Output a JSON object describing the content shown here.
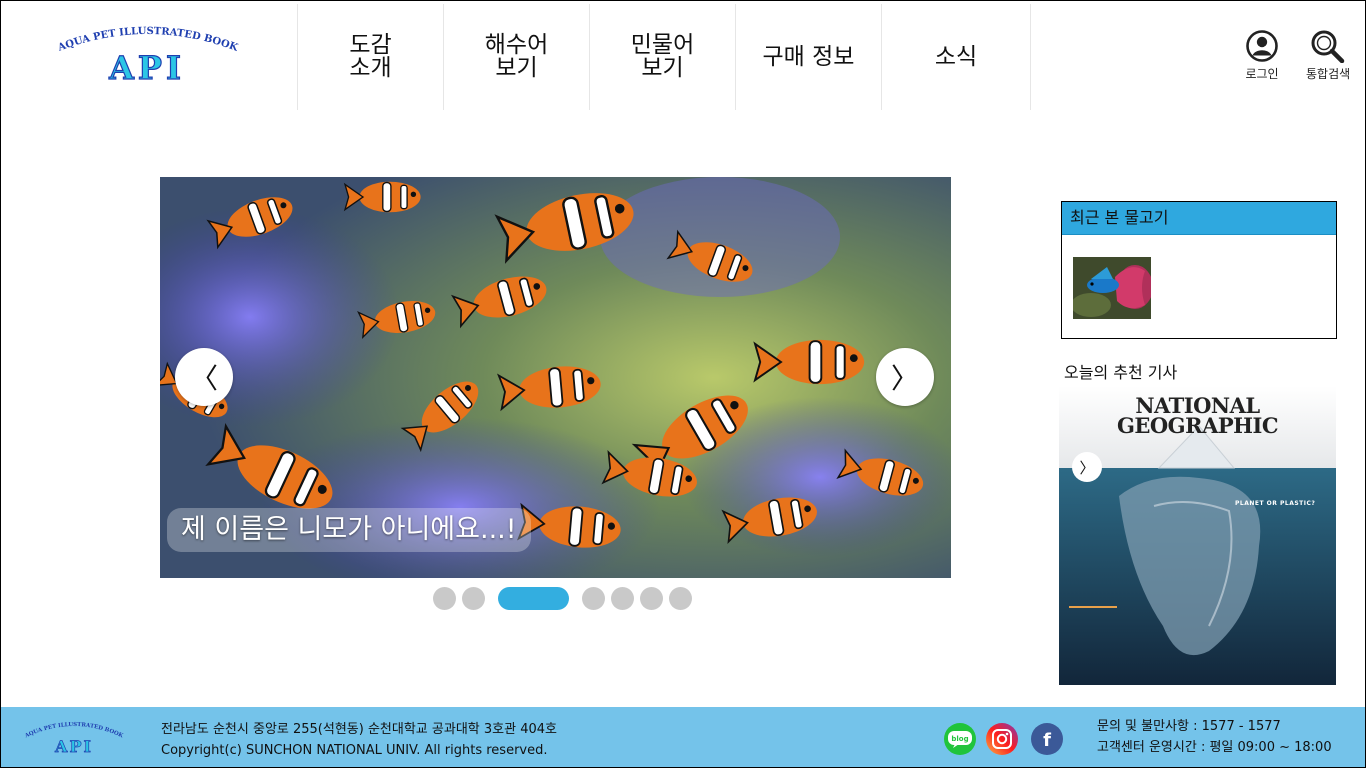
{
  "brand": {
    "logo_text": "API",
    "logo_arc_text": "AQUA PET ILLUSTRATED BOOK"
  },
  "nav": {
    "items": [
      {
        "label": "도감\n소개"
      },
      {
        "label": "해수어\n보기"
      },
      {
        "label": "민물어\n보기"
      },
      {
        "label": "구매 정보"
      },
      {
        "label": "소식"
      }
    ]
  },
  "utility": {
    "login_label": "로그인",
    "search_label": "통합검색"
  },
  "slider": {
    "caption": "제 이름은 니모가 아니에요...!",
    "prev_glyph": "〈",
    "next_glyph": "〉",
    "slide_count": 7,
    "active_index": 2
  },
  "recent": {
    "title": "최근 본 물고기"
  },
  "recommended": {
    "title": "오늘의 추천 기사",
    "magazine_title": "NATIONAL\nGEOGRAPHIC",
    "magazine_subtitle": "PLANET OR PLASTIC?",
    "arrow_glyph": "〉"
  },
  "footer": {
    "address": "전라남도 순천시 중앙로 255(석현동) 순천대학교 공과대학 3호관 404호",
    "copyright": "Copyright(c) SUNCHON NATIONAL UNIV. All rights reserved.",
    "blog_label": "blog",
    "facebook_label": "f",
    "contact_line": "문의 및 불만사항 : 1577 - 1577",
    "hours_line": "고객센터 운영시간 : 평일 09:00 ~ 18:00"
  },
  "colors": {
    "accent": "#33aee0",
    "footer_bg": "#74c3ea",
    "logo_blue": "#1f3fb0",
    "logo_cyan": "#2bc6e6"
  }
}
